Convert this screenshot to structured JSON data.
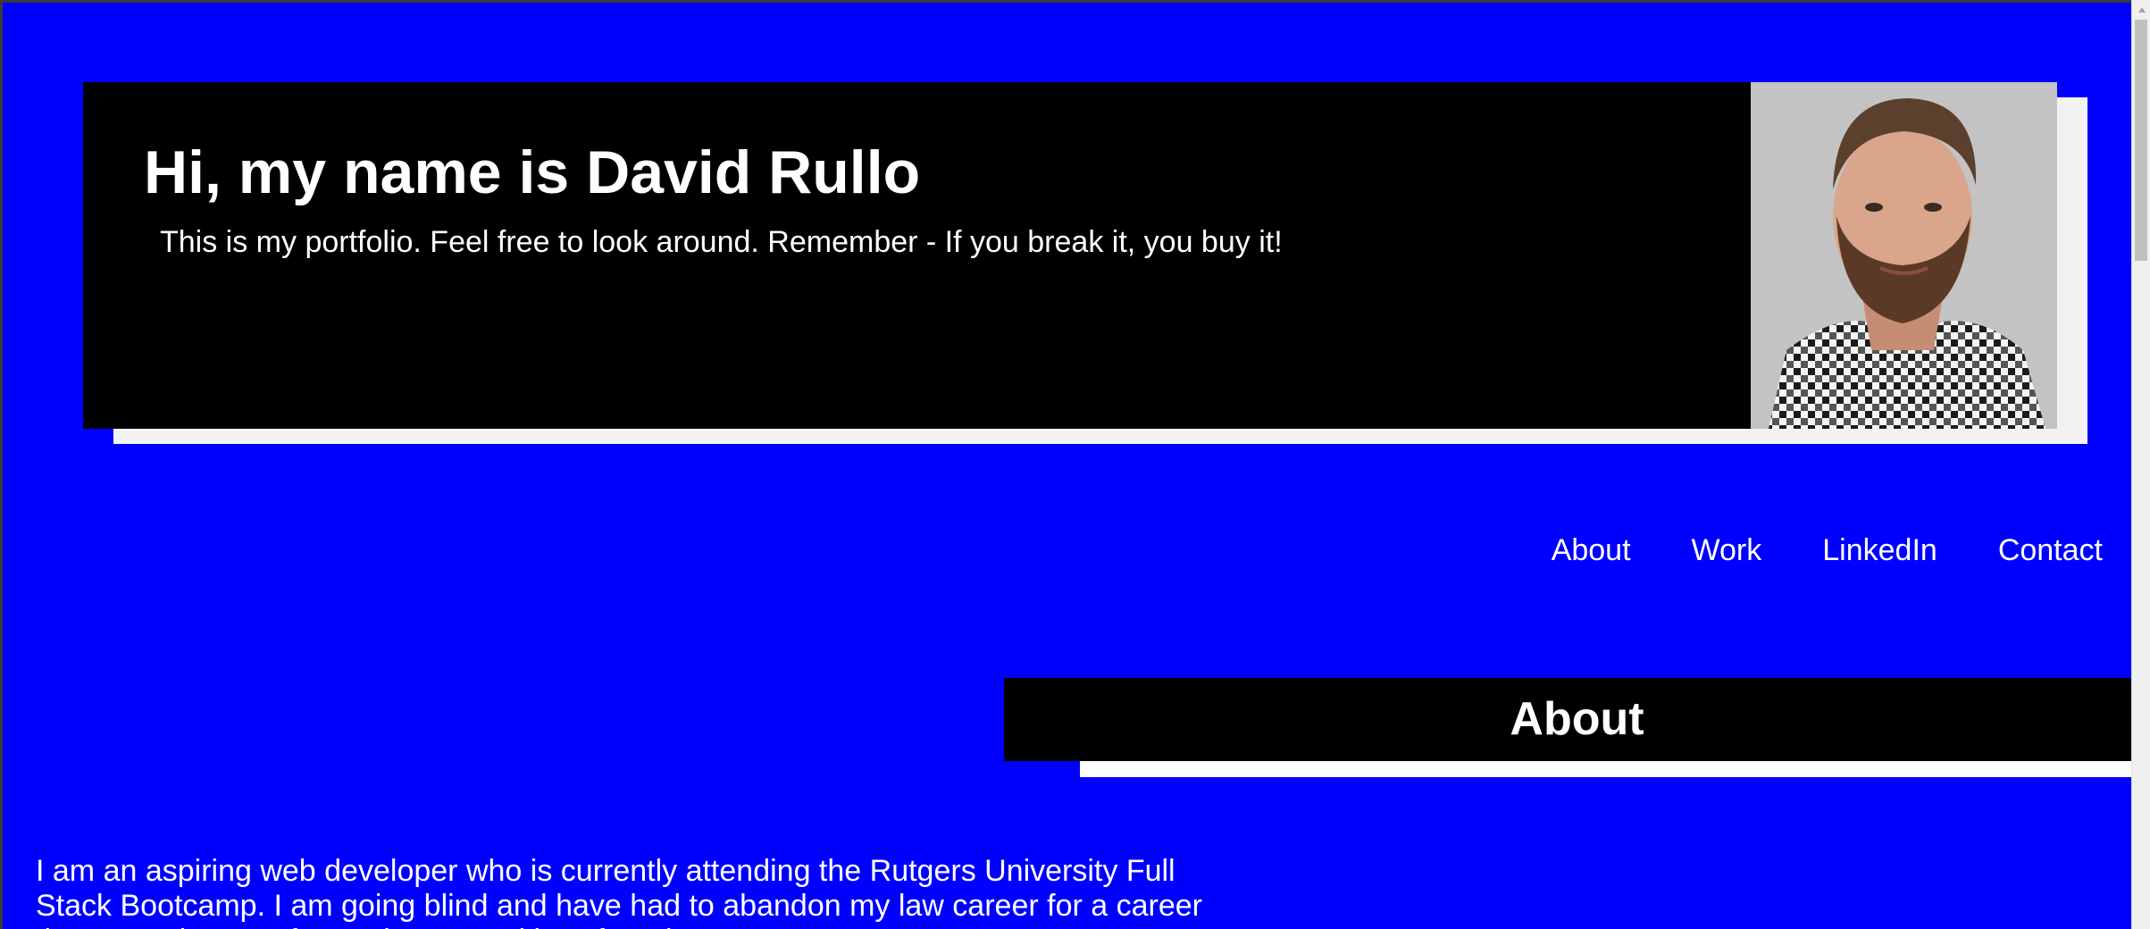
{
  "header": {
    "title": "Hi, my name is David Rullo",
    "subtitle": "This is my portfolio. Feel free to look around. Remember - If you break it, you buy it!"
  },
  "nav": {
    "items": [
      {
        "label": "About"
      },
      {
        "label": "Work"
      },
      {
        "label": "LinkedIn"
      },
      {
        "label": "Contact"
      }
    ]
  },
  "about": {
    "heading": "About",
    "text": "I am an aspiring web developer who is currently attending the Rutgers University Full Stack Bootcamp. I am going blind and have had to abandon my law career for a career that I can do more from a laptop and less from home."
  },
  "colors": {
    "page_background": "#0000ff",
    "card_background": "#000000",
    "card_shadow": "#f2f2f2",
    "text": "#ffffff"
  },
  "icons": {
    "scroll_up": "triangle-up-icon"
  }
}
